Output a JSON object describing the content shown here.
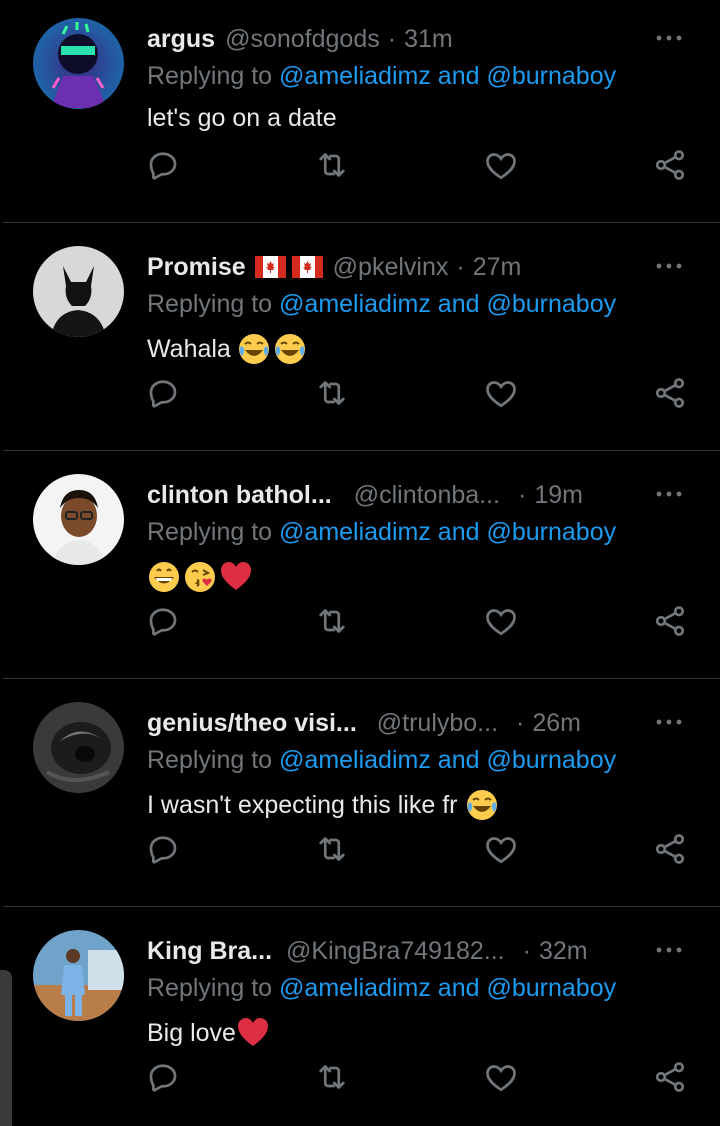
{
  "reply_prefix": "Replying to",
  "reply_mentions": [
    "@ameliadimz",
    "@burnaboy"
  ],
  "reply_and": "and",
  "dot": "·",
  "colors": {
    "link": "#1d9bf0",
    "muted": "#71767b",
    "text": "#e7e9ea",
    "like": "#e0245e"
  },
  "icons": [
    "reply-icon",
    "retweet-icon",
    "like-icon",
    "share-icon",
    "more-icon"
  ],
  "tweets": [
    {
      "name": "argus",
      "handle": "@sonofdgods",
      "time": "31m",
      "text": "let's go on a date",
      "emojis": []
    },
    {
      "name": "Promise",
      "flags": [
        "canada-flag",
        "canada-flag"
      ],
      "handle": "@pkelvinx",
      "time": "27m",
      "text": "Wahala",
      "emojis": [
        "joy",
        "joy"
      ]
    },
    {
      "name": "clinton bathol...",
      "handle": "@clintonba...",
      "time": "19m",
      "text": "",
      "emojis": [
        "grin",
        "kiss",
        "heart"
      ]
    },
    {
      "name": "genius/theo visi...",
      "handle": "@trulybo...",
      "time": "26m",
      "text": "I wasn't expecting this like fr",
      "emojis": [
        "joy"
      ]
    },
    {
      "name": "King Bra...",
      "handle": "@KingBra749182...",
      "time": "32m",
      "text": "Big love",
      "emojis": [
        "heart"
      ]
    }
  ]
}
